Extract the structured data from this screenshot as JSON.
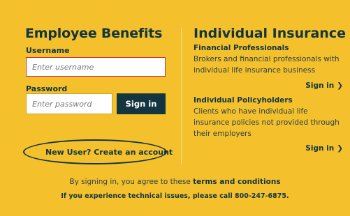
{
  "employee_benefits": {
    "title": "Employee Benefits",
    "username_label": "Username",
    "username_placeholder": "Enter username",
    "password_label": "Password",
    "password_placeholder": "Enter password",
    "signin_label": "Sign in",
    "new_user_label": "New User? Create an account"
  },
  "individual_insurance": {
    "title": "Individual Insurance",
    "financial_title": "Financial Professionals",
    "financial_desc": "Brokers and financial professionals with individual life insurance business",
    "financial_signin": "Sign in",
    "policyholders_title": "Individual Policyholders",
    "policyholders_desc": "Clients who have individual life insurance policies not provided through their employers",
    "policyholders_signin": "Sign in",
    "chevron_icon": "chevron-right-icon"
  },
  "footer": {
    "terms_prefix": "By signing in, you agree to these",
    "terms_link": "terms and conditions",
    "tech_text": "If you experience technical issues, please call 800-247-6875."
  },
  "colors": {
    "background": "#f4c12c",
    "primary": "#12353f",
    "input_error_border": "#cc3333"
  }
}
